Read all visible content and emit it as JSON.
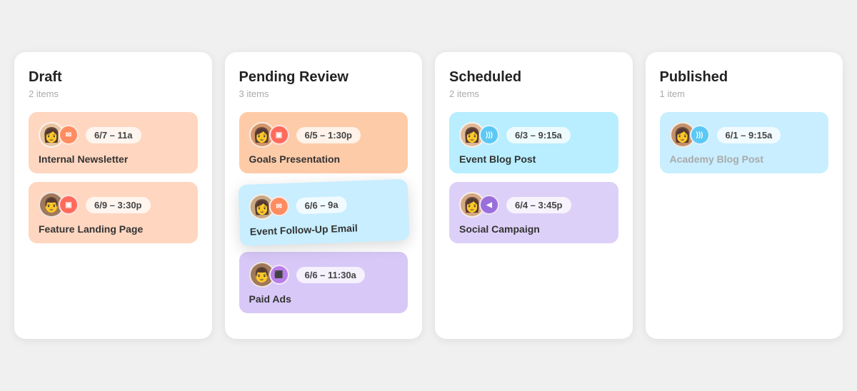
{
  "board": {
    "columns": [
      {
        "id": "draft",
        "title": "Draft",
        "count": "2 items",
        "cards": [
          {
            "id": "draft-1",
            "avatarEmoji": "👩",
            "avatarClass": "face-1",
            "badgeClass": "badge-email",
            "badgeIcon": "✉",
            "date": "6/7 – 11a",
            "title": "Internal Newsletter",
            "cardClass": "card-draft-1"
          },
          {
            "id": "draft-2",
            "avatarEmoji": "👨",
            "avatarClass": "face-4",
            "badgeClass": "badge-screen",
            "badgeIcon": "🖥",
            "date": "6/9 – 3:30p",
            "title": "Feature Landing Page",
            "cardClass": "card-draft-2"
          }
        ]
      },
      {
        "id": "pending",
        "title": "Pending Review",
        "count": "3 items",
        "cards": [
          {
            "id": "pending-1",
            "avatarEmoji": "👩",
            "avatarClass": "face-2",
            "badgeClass": "badge-screen",
            "badgeIcon": "▣",
            "date": "6/5 – 1:30p",
            "title": "Goals Presentation",
            "cardClass": "card-pending-1"
          },
          {
            "id": "pending-2",
            "avatarEmoji": "👩",
            "avatarClass": "face-3",
            "badgeClass": "badge-email",
            "badgeIcon": "✉",
            "date": "6/6 – 9a",
            "title": "Event Follow-Up Email",
            "cardClass": "card-pending-2"
          },
          {
            "id": "pending-3",
            "avatarEmoji": "👨",
            "avatarClass": "face-4",
            "badgeClass": "badge-tag",
            "badgeIcon": "🏷",
            "date": "6/6 – 11:30a",
            "title": "Paid Ads",
            "cardClass": "card-pending-3"
          }
        ]
      },
      {
        "id": "scheduled",
        "title": "Scheduled",
        "count": "2 items",
        "cards": [
          {
            "id": "sched-1",
            "avatarEmoji": "👩",
            "avatarClass": "face-5",
            "badgeClass": "badge-rss",
            "badgeIcon": "◉",
            "date": "6/3 – 9:15a",
            "title": "Event Blog Post",
            "cardClass": "card-sched-1"
          },
          {
            "id": "sched-2",
            "avatarEmoji": "👩",
            "avatarClass": "face-6",
            "badgeClass": "badge-mega",
            "badgeIcon": "📢",
            "date": "6/4 – 3:45p",
            "title": "Social Campaign",
            "cardClass": "card-sched-2"
          }
        ]
      },
      {
        "id": "published",
        "title": "Published",
        "count": "1 item",
        "cards": [
          {
            "id": "pub-1",
            "avatarEmoji": "👩",
            "avatarClass": "face-7",
            "badgeClass": "badge-rss",
            "badgeIcon": "◉",
            "date": "6/1 – 9:15a",
            "title": "Academy Blog Post",
            "cardClass": "card-pub-1"
          }
        ]
      }
    ]
  }
}
